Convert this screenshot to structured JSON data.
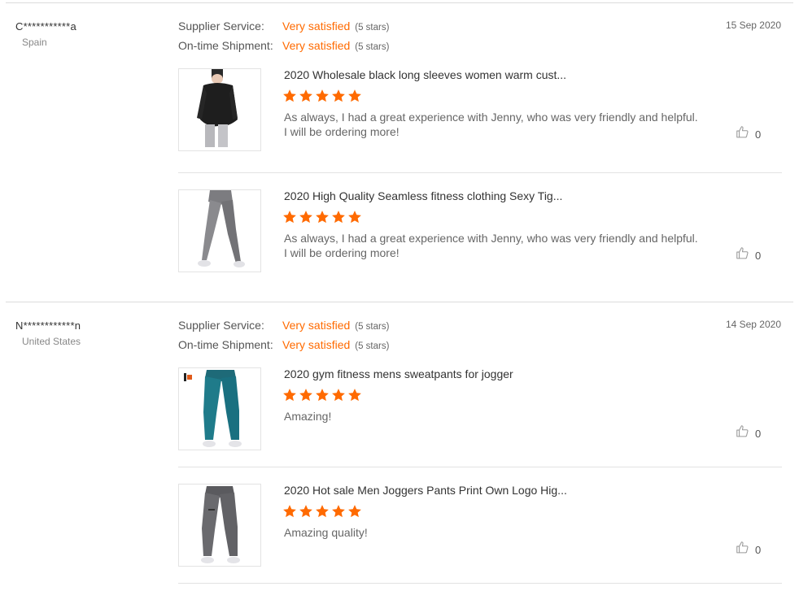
{
  "colors": {
    "accent": "#ff6a00",
    "divider": "#dcdcdc"
  },
  "reviews": [
    {
      "buyer": "C***********a",
      "country": "Spain",
      "date": "15 Sep 2020",
      "supplier_service": {
        "label": "Supplier Service:",
        "value": "Very satisfied",
        "stars": "(5 stars)"
      },
      "ontime_shipment": {
        "label": "On-time Shipment:",
        "value": "Very satisfied",
        "stars": "(5 stars)"
      },
      "products": [
        {
          "title": "2020 Wholesale black long sleeves women warm cust...",
          "rating": 5,
          "text": "As always, I had a great experience with Jenny, who was very friendly and helpful. I will be ordering more!",
          "likes": "0",
          "thumb": "black-hoodie-photo"
        },
        {
          "title": "2020 High Quality Seamless fitness clothing Sexy Tig...",
          "rating": 5,
          "text": "As always, I had a great experience with Jenny, who was very friendly and helpful. I will be ordering more!",
          "likes": "0",
          "thumb": "grey-leggings-photo"
        }
      ]
    },
    {
      "buyer": "N************n",
      "country": "United States",
      "date": "14 Sep 2020",
      "supplier_service": {
        "label": "Supplier Service:",
        "value": "Very satisfied",
        "stars": "(5 stars)"
      },
      "ontime_shipment": {
        "label": "On-time Shipment:",
        "value": "Very satisfied",
        "stars": "(5 stars)"
      },
      "products": [
        {
          "title": "2020 gym fitness mens sweatpants for jogger",
          "rating": 5,
          "text": "Amazing!",
          "likes": "0",
          "thumb": "teal-joggers-photo"
        },
        {
          "title": "2020 Hot sale Men Joggers Pants Print Own Logo Hig...",
          "rating": 5,
          "text": "Amazing quality!",
          "likes": "0",
          "thumb": "grey-joggers-photo"
        }
      ]
    }
  ]
}
